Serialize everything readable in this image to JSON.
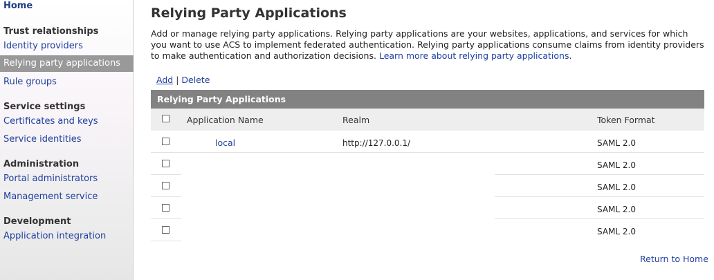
{
  "sidebar": {
    "home": "Home",
    "sections": [
      {
        "title": "Trust relationships",
        "items": [
          "Identity providers",
          "Relying party applications",
          "Rule groups"
        ]
      },
      {
        "title": "Service settings",
        "items": [
          "Certificates and keys",
          "Service identities"
        ]
      },
      {
        "title": "Administration",
        "items": [
          "Portal administrators",
          "Management service"
        ]
      },
      {
        "title": "Development",
        "items": [
          "Application integration"
        ]
      }
    ],
    "active_item": "Relying party applications"
  },
  "main": {
    "title": "Relying Party Applications",
    "description": "Add or manage relying party applications. Relying party applications are your websites, applications, and services for which you want to use ACS to implement federated authentication. Relying party applications consume claims from identity providers to make authentication and authorization decisions.",
    "learn_more": "Learn more about relying party applications",
    "learn_more_suffix": ".",
    "actions": {
      "add": "Add",
      "separator": "|",
      "delete": "Delete"
    },
    "table": {
      "caption": "Relying Party Applications",
      "columns": [
        "Application Name",
        "Realm",
        "Token Format"
      ],
      "rows": [
        {
          "name": "local",
          "realm": "http://127.0.0.1/",
          "token_format": "SAML 2.0"
        },
        {
          "name": "",
          "realm": "",
          "token_format": "SAML 2.0"
        },
        {
          "name": "",
          "realm": "",
          "token_format": "SAML 2.0"
        },
        {
          "name": "",
          "realm": "",
          "token_format": "SAML 2.0"
        },
        {
          "name": "",
          "realm": "",
          "token_format": "SAML 2.0"
        }
      ]
    },
    "return_link": "Return to Home"
  }
}
